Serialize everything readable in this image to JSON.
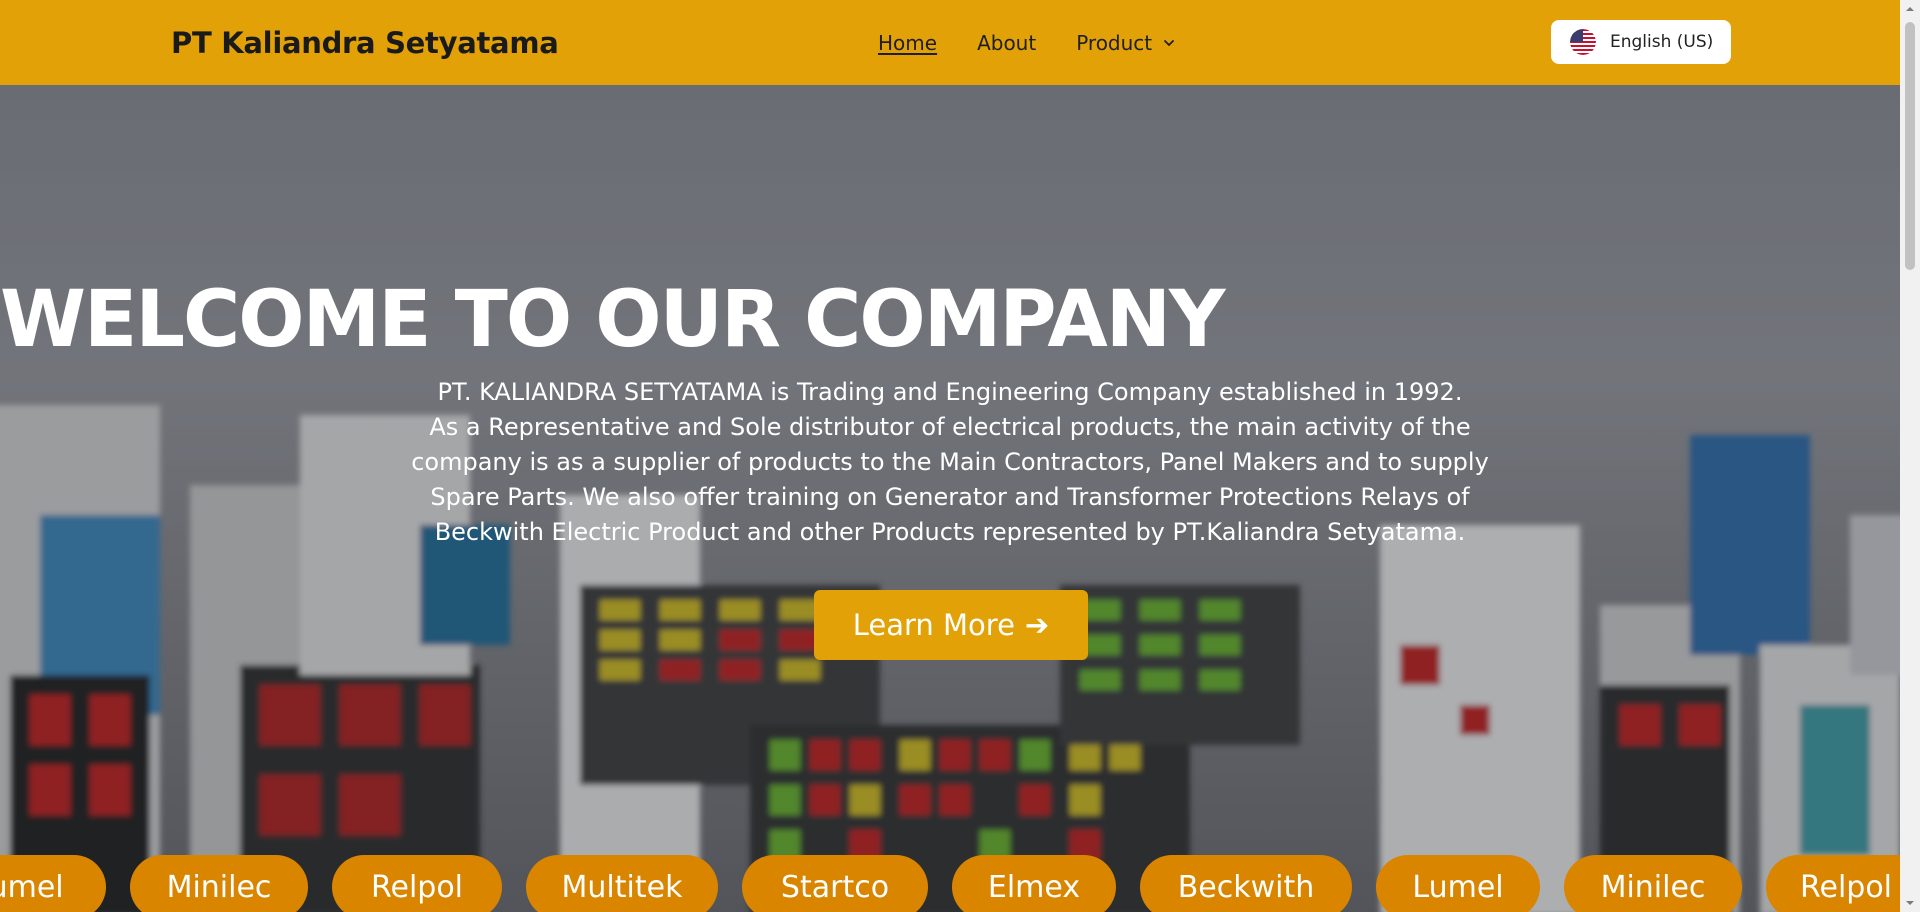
{
  "header": {
    "brand": "PT Kaliandra Setyatama",
    "nav": [
      {
        "label": "Home",
        "active": true
      },
      {
        "label": "About",
        "active": false
      },
      {
        "label": "Product",
        "active": false,
        "has_dropdown": true
      }
    ],
    "language": {
      "label": "English (US)",
      "icon": "us-flag-icon"
    }
  },
  "hero": {
    "title": "WELCOME TO OUR COMPANY",
    "lines": [
      "PT. KALIANDRA SETYATAMA is Trading and Engineering Company established in 1992.",
      "As a Representative and Sole distributor of electrical products, the main activity of the",
      "company is as a supplier of products to the Main Contractors, Panel Makers and to supply",
      "Spare Parts. We also offer training on Generator and Transformer Protections Relays of",
      "Beckwith Electric Product and other Products represented by PT.Kaliandra Setyatama."
    ],
    "cta_label": "Learn More",
    "cta_icon": "arrow-right-icon"
  },
  "brands": [
    "Lumel",
    "Minilec",
    "Relpol",
    "Multitek",
    "Startco",
    "Elmex",
    "Beckwith",
    "Lumel",
    "Minilec",
    "Relpol"
  ],
  "colors": {
    "accent": "#e2a106",
    "pill": "#d98500",
    "text_on_dark": "#ffffff"
  }
}
